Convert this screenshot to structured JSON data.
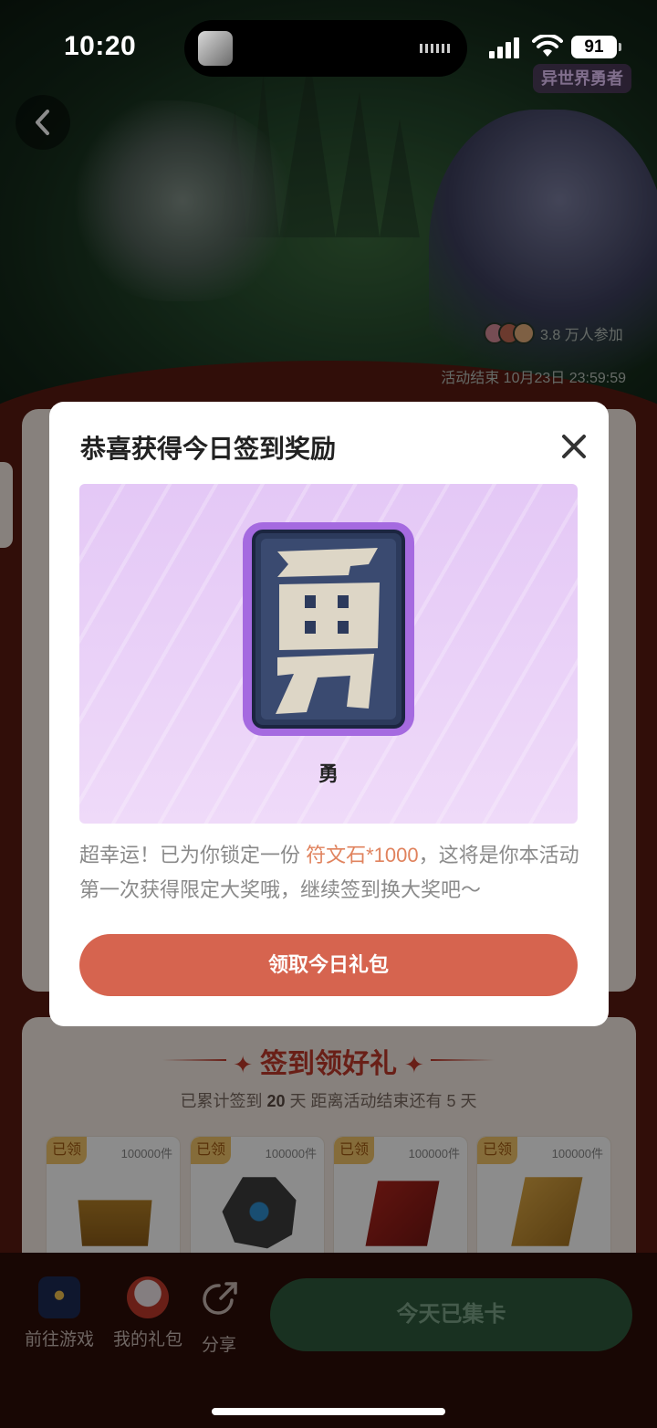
{
  "status_bar": {
    "time": "10:20",
    "battery": "91"
  },
  "banner": {
    "event_tag": "异世界勇者",
    "participants": "3.8 万人参加",
    "end_time": "活动结束 10月23日 23:59:59"
  },
  "signin": {
    "title": "签到领好礼",
    "subtitle_prefix": "已累计签到",
    "days": "20",
    "subtitle_mid": "天  距离活动结束还有 5 天",
    "cards": [
      {
        "status": "已领",
        "count": "100000件",
        "item": "treasure-chest"
      },
      {
        "status": "已领",
        "count": "100000件",
        "item": "rune-stone"
      },
      {
        "status": "已领",
        "count": "100000件",
        "item": "red-scroll"
      },
      {
        "status": "已领",
        "count": "100000件",
        "item": "gold-scroll"
      }
    ]
  },
  "bottom_bar": {
    "go_game": "前往游戏",
    "my_gifts": "我的礼包",
    "share": "分享",
    "collect_button": "今天已集卡"
  },
  "modal": {
    "title": "恭喜获得今日签到奖励",
    "reward_name": "勇",
    "desc_part1": "超幸运！已为你锁定一份 ",
    "desc_highlight": "符文石*1000",
    "desc_part2": "，这将是你本活动第一次获得限定大奖哦，继续签到换大奖吧～",
    "claim_button": "领取今日礼包"
  },
  "colors": {
    "page_background": "#5a1a12",
    "accent": "#d6644f",
    "highlight": "#e0835e",
    "reward_box": "#e4c8f6",
    "claimed_badge": "#f3c56b"
  }
}
